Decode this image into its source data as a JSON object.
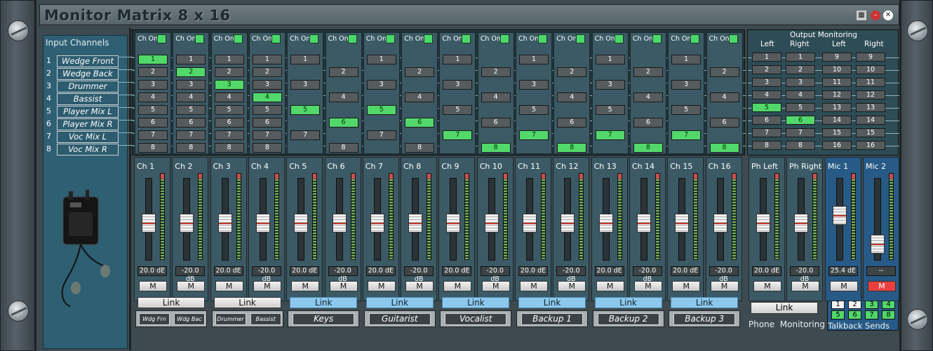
{
  "window": {
    "title": "Monitor Matrix 8 x 16"
  },
  "inputs": {
    "title": "Input Channels",
    "rows": [
      {
        "num": "1",
        "label": "Wedge Front"
      },
      {
        "num": "2",
        "label": "Wedge Back"
      },
      {
        "num": "3",
        "label": "Drummer"
      },
      {
        "num": "4",
        "label": "Bassist"
      },
      {
        "num": "5",
        "label": "Player Mix L"
      },
      {
        "num": "6",
        "label": "Player Mix R"
      },
      {
        "num": "7",
        "label": "Voc Mix L"
      },
      {
        "num": "8",
        "label": "Voc Mix R"
      }
    ]
  },
  "matrix": {
    "ch_on_label": "Ch On",
    "active_by_channel": [
      1,
      2,
      3,
      4,
      5,
      6,
      5,
      6,
      7,
      8,
      7,
      8,
      7,
      8,
      7,
      8
    ],
    "odd_rows_only_even_channels": true
  },
  "output_monitoring": {
    "title": "Output Monitoring",
    "headers": [
      "Left",
      "Right",
      "Left",
      "Right"
    ],
    "col1": [
      "1",
      "2",
      "3",
      "4",
      "5",
      "6",
      "7",
      "8"
    ],
    "col2": [
      "1",
      "2",
      "3",
      "4",
      "5",
      "6",
      "7",
      "8"
    ],
    "col3": [
      "9",
      "10",
      "11",
      "12",
      "13",
      "14",
      "15",
      "16"
    ],
    "col4": [
      "9",
      "10",
      "11",
      "12",
      "13",
      "14",
      "15",
      "16"
    ],
    "active": {
      "col1": 5,
      "col2": 6
    }
  },
  "channels": [
    {
      "label": "Ch 1",
      "db": "20.0 dE",
      "fader": 0.46
    },
    {
      "label": "Ch 2",
      "db": "-20.0 dB",
      "fader": 0.46
    },
    {
      "label": "Ch 3",
      "db": "20.0 dE",
      "fader": 0.46
    },
    {
      "label": "Ch 4",
      "db": "-20.0 dB",
      "fader": 0.46
    },
    {
      "label": "Ch 5",
      "db": "20.0 dE",
      "fader": 0.46
    },
    {
      "label": "Ch 6",
      "db": "-20.0 dB",
      "fader": 0.46
    },
    {
      "label": "Ch 7",
      "db": "20.0 dE",
      "fader": 0.46
    },
    {
      "label": "Ch 8",
      "db": "-20.0 dB",
      "fader": 0.46
    },
    {
      "label": "Ch 9",
      "db": "20.0 dE",
      "fader": 0.46
    },
    {
      "label": "Ch 10",
      "db": "-20.0 dB",
      "fader": 0.46
    },
    {
      "label": "Ch 11",
      "db": "20.0 dE",
      "fader": 0.46
    },
    {
      "label": "Ch 12",
      "db": "-20.0 dB",
      "fader": 0.46
    },
    {
      "label": "Ch 13",
      "db": "20.0 dE",
      "fader": 0.46
    },
    {
      "label": "Ch 14",
      "db": "-20.0 dB",
      "fader": 0.46
    },
    {
      "label": "Ch 15",
      "db": "20.0 dE",
      "fader": 0.46
    },
    {
      "label": "Ch 16",
      "db": "-20.0 dB",
      "fader": 0.46
    }
  ],
  "mute_label": "M",
  "link_label": "Link",
  "pairs": [
    {
      "style": "gray",
      "names": [
        "Wdg Frn",
        "Wdg Bac"
      ]
    },
    {
      "style": "gray",
      "names": [
        "Drummer",
        "Bassist"
      ]
    },
    {
      "style": "blue",
      "name": "Keys"
    },
    {
      "style": "blue",
      "name": "Guitarist"
    },
    {
      "style": "blue",
      "name": "Vocalist"
    },
    {
      "style": "blue",
      "name": "Backup 1"
    },
    {
      "style": "blue",
      "name": "Backup 2"
    },
    {
      "style": "blue",
      "name": "Backup 3"
    }
  ],
  "outputs": [
    {
      "label": "Ph Left",
      "db": "20.0 dE",
      "fader": 0.46,
      "mute_red": false,
      "mic": false
    },
    {
      "label": "Ph Right",
      "db": "-20.0 dB",
      "fader": 0.46,
      "mute_red": false,
      "mic": false
    },
    {
      "label": "Mic 1",
      "db": "25.4 dE",
      "fader": 0.55,
      "mute_red": false,
      "mic": true
    },
    {
      "label": "Mic 2",
      "db": "--",
      "fader": 0.2,
      "mute_red": true,
      "mic": true
    }
  ],
  "phone": {
    "link": "Link",
    "label": "Phone  Monitoring"
  },
  "talkback": {
    "label": "Talkback Sends",
    "buttons": [
      {
        "n": "1",
        "on": false
      },
      {
        "n": "2",
        "on": false
      },
      {
        "n": "3",
        "on": true
      },
      {
        "n": "4",
        "on": true
      },
      {
        "n": "5",
        "on": true
      },
      {
        "n": "6",
        "on": true
      },
      {
        "n": "7",
        "on": true
      },
      {
        "n": "8",
        "on": true
      }
    ]
  }
}
